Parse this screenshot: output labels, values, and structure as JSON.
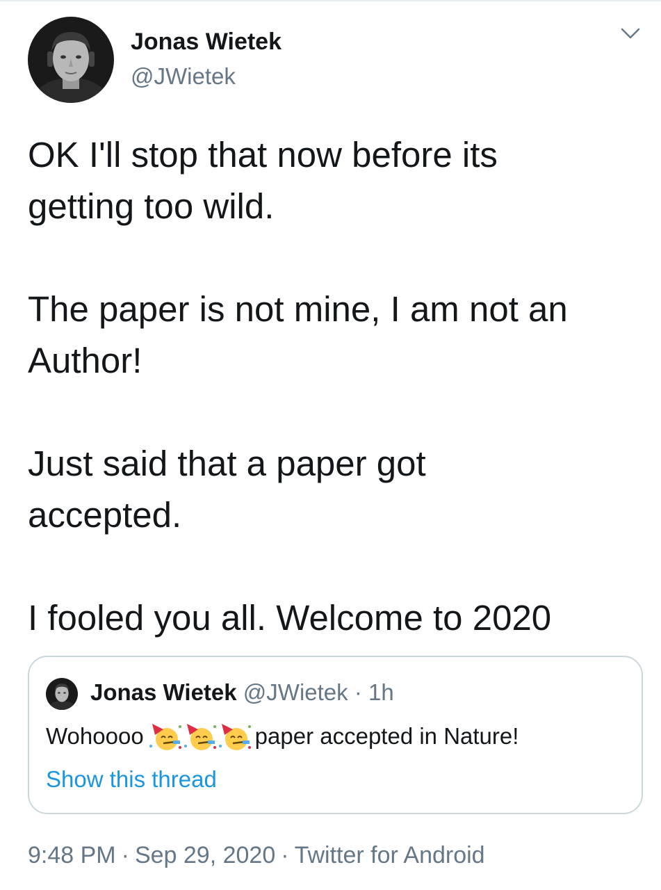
{
  "tweet": {
    "author_name": "Jonas Wietek",
    "author_handle": "@JWietek",
    "paragraphs": [
      [
        "OK I'll stop that now before its",
        "getting too wild."
      ],
      [
        "The paper is not mine, I am not an",
        "Author!"
      ],
      [
        "Just said that a paper got",
        "accepted."
      ],
      [
        "I fooled you all. Welcome to 2020"
      ]
    ],
    "time": "9:48 PM",
    "date": "Sep 29, 2020",
    "source": "Twitter for Android",
    "separator": "·"
  },
  "quoted": {
    "author_name": "Jonas Wietek",
    "author_handle": "@JWietek",
    "age": "· 1h",
    "text_before": "Wohoooo",
    "emoji_name": "partying-face-icon",
    "emoji_count": 3,
    "text_after": "paper accepted in Nature!",
    "show_thread": "Show this thread"
  },
  "colors": {
    "text": "#14171a",
    "secondary": "#657786",
    "link": "#1b95e0",
    "border": "#ccd6dd"
  },
  "icons": {
    "menu": "chevron-down-icon",
    "emoji": "partying-face-icon"
  }
}
